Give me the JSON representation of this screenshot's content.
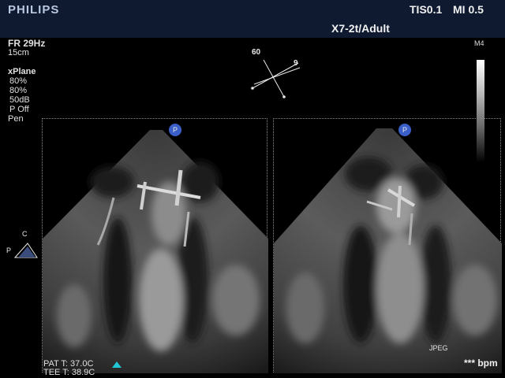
{
  "header": {
    "brand": "PHILIPS",
    "tis": "TIS0.1",
    "mi": "MI 0.5",
    "probe": "X7-2t/Adult"
  },
  "params": {
    "frame_rate": "FR 29Hz",
    "depth": "15cm",
    "mode": "xPlane",
    "gain_1": "80%",
    "gain_2": "80%",
    "dynamic_range": "50dB",
    "persistence": "P Off",
    "preset": "Pen"
  },
  "plane_angle": {
    "primary": "60",
    "secondary": "9"
  },
  "greyscale": {
    "map_label": "M4"
  },
  "orientation": {
    "c_label": "C",
    "p_label": "P"
  },
  "temps": {
    "patient": "PAT T: 37.0C",
    "tee": "TEE T: 38.9C"
  },
  "footer": {
    "format": "JPEG",
    "heart_rate": "*** bpm"
  },
  "colors": {
    "header_bg": "#0f1a30",
    "probe_marker": "#3a5fc8",
    "cursor_marker": "#23c6d6"
  }
}
